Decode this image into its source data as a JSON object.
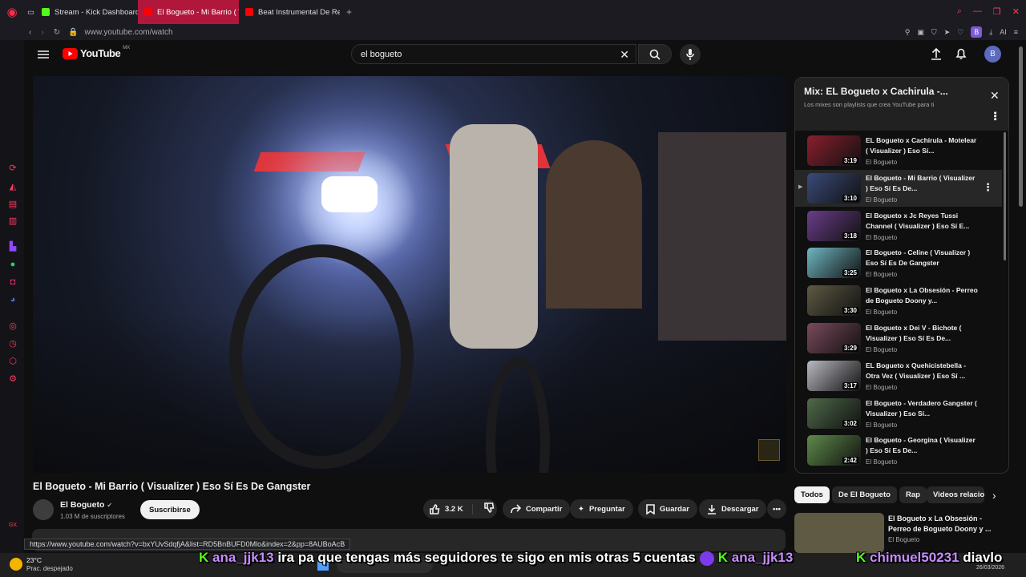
{
  "browser": {
    "tabs": [
      {
        "label": "Stream - Kick Dashboard",
        "color": "#53fc18"
      },
      {
        "label": "El Bogueto - Mi Barrio ( Vi",
        "color": "#ff0000"
      },
      {
        "label": "Beat Instrumental De Regg",
        "color": "#ff0000"
      }
    ],
    "url": "www.youtube.com/watch",
    "profile_initial": "B"
  },
  "youtube": {
    "logo_text": "YouTube",
    "region": "MX",
    "search_value": "el bogueto",
    "avatar_initial": "B"
  },
  "video": {
    "title": "El Bogueto - Mi Barrio ( Visualizer ) Eso Sí Es De Gangster",
    "channel": "El Bogueto",
    "subscribers": "1.03 M de suscriptores",
    "subscribe_label": "Suscribirse",
    "likes": "3.2 K",
    "share_label": "Compartir",
    "ask_label": "Preguntar",
    "save_label": "Guardar",
    "download_label": "Descargar"
  },
  "playlist": {
    "title": "Mix: EL Bogueto x Cachirula -...",
    "subtitle": "Los mixes son playlists que crea YouTube para ti",
    "items": [
      {
        "title": "EL Bogueto x Cachirula - Motelear ( Visualizer ) Eso Sí...",
        "channel": "El Bogueto",
        "duration": "3:19",
        "color": "#8a1f2d"
      },
      {
        "title": "El Bogueto - Mi Barrio ( Visualizer ) Eso Sí Es De...",
        "channel": "El Bogueto",
        "duration": "3:10",
        "color": "#3a4a7a"
      },
      {
        "title": "El Bogueto x Jc Reyes Tussi Channel ( Visualizer ) Eso Sí E...",
        "channel": "El Bogueto",
        "duration": "3:18",
        "color": "#6a3d8a"
      },
      {
        "title": "El Bogueto - Celine ( Visualizer ) Eso Sí Es De Gangster",
        "channel": "El Bogueto",
        "duration": "3:25",
        "color": "#6fb7c2"
      },
      {
        "title": "El Bogueto x La Obsesión - Perreo de Bogueto Doony y...",
        "channel": "El Bogueto",
        "duration": "3:30",
        "color": "#5e5a44"
      },
      {
        "title": "El Bogueto x Dei V - Bichote ( Visualizer ) Eso Sí Es De...",
        "channel": "El Bogueto",
        "duration": "3:29",
        "color": "#7a4a5c"
      },
      {
        "title": "EL Bogueto x Quehicistebella - Otra Vez ( Visualizer ) Eso Sí ...",
        "channel": "El Bogueto",
        "duration": "3:17",
        "color": "#b9b9c2"
      },
      {
        "title": "El Bogueto - Verdadero Gangster ( Visualizer ) Eso Sí...",
        "channel": "El Bogueto",
        "duration": "3:02",
        "color": "#4f6a4a"
      },
      {
        "title": "El Bogueto - Georgina ( Visualizer ) Eso Sí Es De...",
        "channel": "El Bogueto",
        "duration": "2:42",
        "color": "#5e8a4a"
      }
    ]
  },
  "chips": [
    "Todos",
    "De El Bogueto",
    "Rap",
    "Videos relacio"
  ],
  "related": {
    "title": "El Bogueto x La Obsesión - Perreo de Bogueto Doony y ...",
    "channel": "El Bogueto"
  },
  "status_url": "https://www.youtube.com/watch?v=bxYUvSdqfjA&list=RD5BnBUFD0Mlo&index=2&pp=8AUBoAcB",
  "weather": {
    "temp": "23°C",
    "desc": "Prac. despejado"
  },
  "clock": {
    "date": "26/03/2026"
  },
  "stream_overlay": [
    {
      "user": "ana_jjk13",
      "message": "ira pa que tengas más seguidores te sigo en mis otras 5 cuentas"
    },
    {
      "user": "ana_jjk13",
      "message": ""
    },
    {
      "user": "chimuel50231",
      "message": "diavlo"
    }
  ]
}
